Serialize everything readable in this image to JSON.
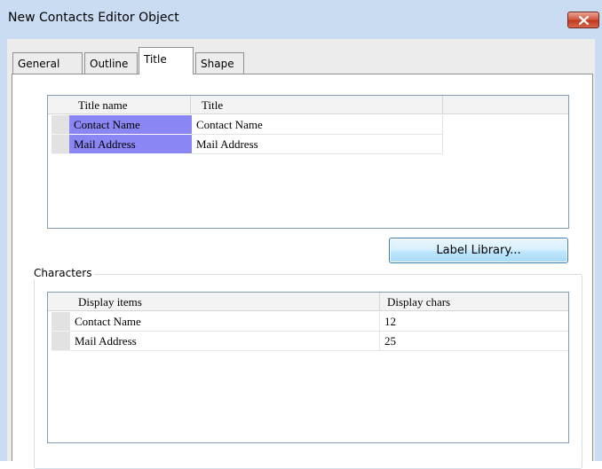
{
  "window": {
    "title": "New Contacts Editor Object"
  },
  "tabs": [
    {
      "label": "General",
      "active": false
    },
    {
      "label": "Outline",
      "active": false
    },
    {
      "label": "Title",
      "active": true
    },
    {
      "label": "Shape",
      "active": false
    }
  ],
  "title_grid": {
    "columns": [
      "Title name",
      "Title"
    ],
    "rows": [
      {
        "title_name": "Contact Name",
        "title": "Contact Name"
      },
      {
        "title_name": "Mail Address",
        "title": "Mail Address"
      }
    ]
  },
  "label_library_button": "Label Library...",
  "characters": {
    "group_label": "Characters",
    "columns": [
      "Display items",
      "Display chars"
    ],
    "rows": [
      {
        "item": "Contact Name",
        "chars": "12"
      },
      {
        "item": "Mail Address",
        "chars": "25"
      }
    ]
  },
  "colors": {
    "selection": "#8a87f5",
    "close_button": "#c0391f",
    "titlebar": "#c9dcf2"
  },
  "icons": {
    "close": "close-icon"
  }
}
